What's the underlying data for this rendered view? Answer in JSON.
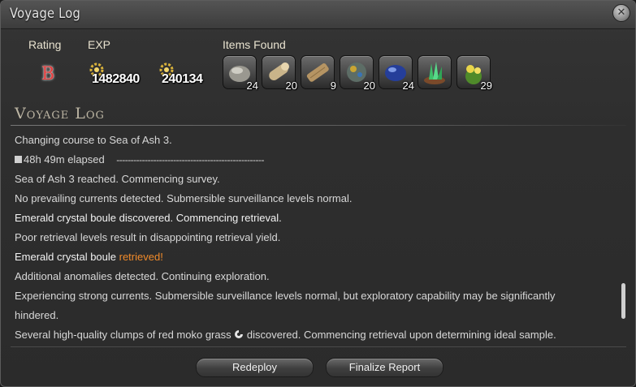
{
  "window": {
    "title": "Voyage Log",
    "close_icon": "close-icon"
  },
  "summary": {
    "rating_label": "Rating",
    "rating_value": "B",
    "exp_label": "EXP",
    "exp_values": [
      "1482840",
      "240134"
    ],
    "items_label": "Items Found",
    "items": [
      {
        "icon": "stone-item-icon",
        "count": "24"
      },
      {
        "icon": "log-item-icon",
        "count": "20"
      },
      {
        "icon": "lumber-item-icon",
        "count": "9"
      },
      {
        "icon": "ore-item-icon",
        "count": "20"
      },
      {
        "icon": "blue-crystal-item-icon",
        "count": "24"
      },
      {
        "icon": "green-crystal-item-icon",
        "count": ""
      },
      {
        "icon": "flower-item-icon",
        "count": "29"
      }
    ]
  },
  "log": {
    "title": "Voyage Log",
    "lines": [
      "Changing course to Sea of Ash 3.",
      "48h 49m elapsed",
      "Sea of Ash 3 reached. Commencing survey.",
      "No prevailing currents detected. Submersible surveillance levels normal.",
      "Emerald crystal boule discovered. Commencing retrieval.",
      "Poor retrieval levels result in disappointing retrieval yield.",
      "Emerald crystal boule",
      "retrieved!",
      "Additional anomalies detected. Continuing exploration.",
      "Experiencing strong currents. Submersible surveillance levels normal, but exploratory capability may be significantly",
      "hindered.",
      "Several high-quality clumps of red moko grass",
      "discovered. Commencing retrieval upon determining ideal sample."
    ],
    "elapsed_dashes": "----------------------------------------------------"
  },
  "buttons": {
    "redeploy": "Redeploy",
    "finalize": "Finalize Report"
  },
  "colors": {
    "rating": "#e23b3b",
    "highlight": "#f08a2a"
  }
}
